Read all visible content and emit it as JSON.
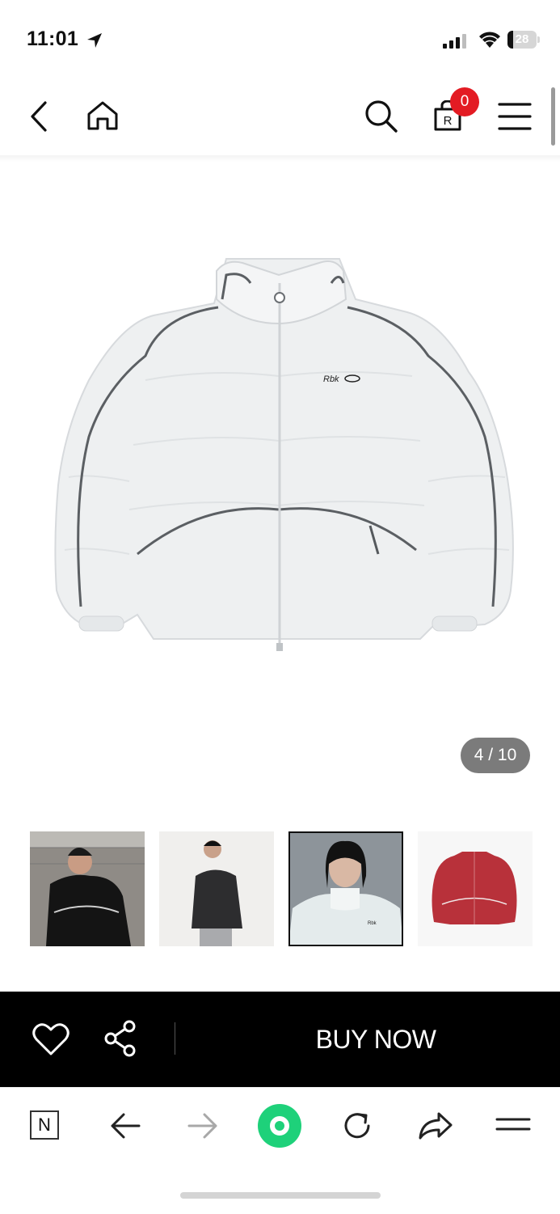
{
  "status_bar": {
    "time": "11:01",
    "battery": "28",
    "icons": [
      "location-arrow-icon",
      "signal-icon",
      "wifi-icon",
      "battery-icon"
    ]
  },
  "header": {
    "icons": [
      "back-icon",
      "home-icon",
      "search-icon",
      "cart-icon",
      "menu-icon"
    ],
    "cart_count": "0",
    "cart_letter": "R"
  },
  "product": {
    "image_counter": "4 / 10",
    "logo_text": "Rbk",
    "colors": {
      "jacket": "#eef0f1",
      "piping": "#5b5f63"
    }
  },
  "thumbnails": [
    {
      "label": "model-black-jacket-outdoor",
      "selected": false
    },
    {
      "label": "model-black-jacket-studio",
      "selected": false
    },
    {
      "label": "model-white-jacket",
      "selected": true
    },
    {
      "label": "red-jacket",
      "selected": false
    }
  ],
  "buy_bar": {
    "buy_label": "BUY NOW",
    "icons": [
      "heart-icon",
      "share-icon"
    ]
  },
  "browser_toolbar": {
    "n_label": "N",
    "icons": [
      "n-icon",
      "back-arrow-icon",
      "forward-arrow-icon",
      "green-home-icon",
      "refresh-icon",
      "share-forward-icon",
      "menu-icon"
    ]
  },
  "colors": {
    "badge": "#e31b23",
    "green": "#1ed17a",
    "bar": "#000000"
  }
}
